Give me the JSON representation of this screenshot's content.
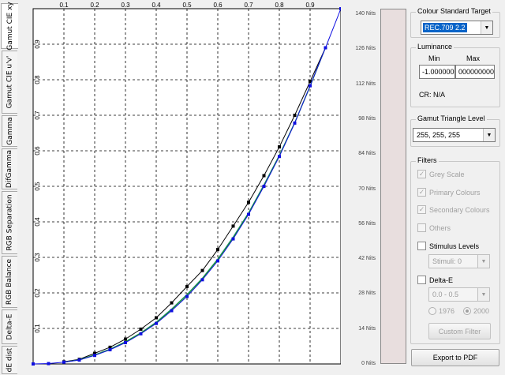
{
  "tabs": [
    {
      "label": "Gamut CIE xy"
    },
    {
      "label": "Gamut CIE u'v'"
    },
    {
      "label": "Gamma"
    },
    {
      "label": "DifGamma"
    },
    {
      "label": "RGB Separation"
    },
    {
      "label": "RGB Balance"
    },
    {
      "label": "Delta-E"
    },
    {
      "label": "dE dist"
    }
  ],
  "chart_data": {
    "type": "line",
    "x_ticks": [
      "0.1",
      "0.2",
      "0.3",
      "0.4",
      "0.5",
      "0.6",
      "0.7",
      "0.8",
      "0.9"
    ],
    "y_ticks": [
      "0.1",
      "0.2",
      "0.3",
      "0.4",
      "0.5",
      "0.6",
      "0.7",
      "0.8",
      "0.9"
    ],
    "xlim": [
      0,
      1
    ],
    "ylim": [
      0,
      1
    ],
    "grid": true,
    "series": [
      {
        "color": "#000000",
        "marker": "square",
        "x": [
          0.1,
          0.15,
          0.2,
          0.25,
          0.3,
          0.35,
          0.4,
          0.45,
          0.5,
          0.55,
          0.6,
          0.65,
          0.7,
          0.75,
          0.8,
          0.85,
          0.9,
          0.95
        ],
        "y": [
          0.006,
          0.013,
          0.03,
          0.047,
          0.07,
          0.098,
          0.13,
          0.172,
          0.218,
          0.263,
          0.322,
          0.388,
          0.455,
          0.53,
          0.611,
          0.7,
          0.795,
          0.89
        ]
      },
      {
        "color": "#2a8c8c",
        "marker": "none",
        "x": [
          0.1,
          0.15,
          0.2,
          0.25,
          0.3,
          0.35,
          0.4,
          0.45,
          0.5,
          0.55,
          0.6,
          0.65,
          0.7,
          0.75,
          0.8,
          0.85,
          0.9,
          0.95
        ],
        "y": [
          0.005,
          0.012,
          0.026,
          0.042,
          0.063,
          0.088,
          0.118,
          0.155,
          0.196,
          0.242,
          0.296,
          0.358,
          0.426,
          0.505,
          0.588,
          0.68,
          0.783,
          0.89
        ]
      },
      {
        "color": "#10a010",
        "marker": "none",
        "x": [
          0.1,
          0.15,
          0.2,
          0.25,
          0.3,
          0.35,
          0.4,
          0.45,
          0.5,
          0.55,
          0.6,
          0.65,
          0.7,
          0.75,
          0.8,
          0.85,
          0.9,
          0.95
        ],
        "y": [
          0.005,
          0.011,
          0.025,
          0.041,
          0.062,
          0.087,
          0.116,
          0.153,
          0.194,
          0.24,
          0.294,
          0.355,
          0.424,
          0.502,
          0.586,
          0.678,
          0.781,
          0.89
        ]
      },
      {
        "color": "#1010e0",
        "marker": "square",
        "x": [
          0.0,
          0.05,
          0.1,
          0.15,
          0.2,
          0.25,
          0.3,
          0.35,
          0.4,
          0.45,
          0.5,
          0.55,
          0.6,
          0.65,
          0.7,
          0.75,
          0.8,
          0.85,
          0.9,
          0.95,
          1.0
        ],
        "y": [
          0.0,
          0.001,
          0.005,
          0.011,
          0.024,
          0.04,
          0.06,
          0.085,
          0.114,
          0.15,
          0.19,
          0.237,
          0.29,
          0.352,
          0.421,
          0.5,
          0.584,
          0.678,
          0.783,
          0.89,
          1.0
        ]
      }
    ]
  },
  "luminance_scale": {
    "labels": [
      "140 Nits",
      "126 Nits",
      "112 Nits",
      "98 Nits",
      "84 Nits",
      "70 Nits",
      "56 Nits",
      "42 Nits",
      "28 Nits",
      "14 Nits",
      "0 Nits"
    ],
    "bar_color": "#e8dede"
  },
  "colour_standard": {
    "title": "Colour Standard Target",
    "selected": "REC.709 2.2"
  },
  "luminance": {
    "title": "Luminance",
    "min_label": "Min",
    "max_label": "Max",
    "min_value": "-1.000000",
    "max_value": "0000000000",
    "cr": "CR: N/A"
  },
  "gamut_triangle": {
    "title": "Gamut Triangle Level",
    "selected": "255, 255, 255"
  },
  "filters": {
    "title": "Filters",
    "grey_scale": "Grey Scale",
    "primary": "Primary Colours",
    "secondary": "Secondary Colours",
    "others": "Others",
    "stimulus_levels": "Stimulus Levels",
    "stimuli_select": "Stimuli: 0",
    "delta_e": "Delta-E",
    "delta_e_select": "0.0 - 0.5",
    "radio_1976": "1976",
    "radio_2000": "2000",
    "custom_filter": "Custom Filter"
  },
  "export_button": "Export to PDF"
}
